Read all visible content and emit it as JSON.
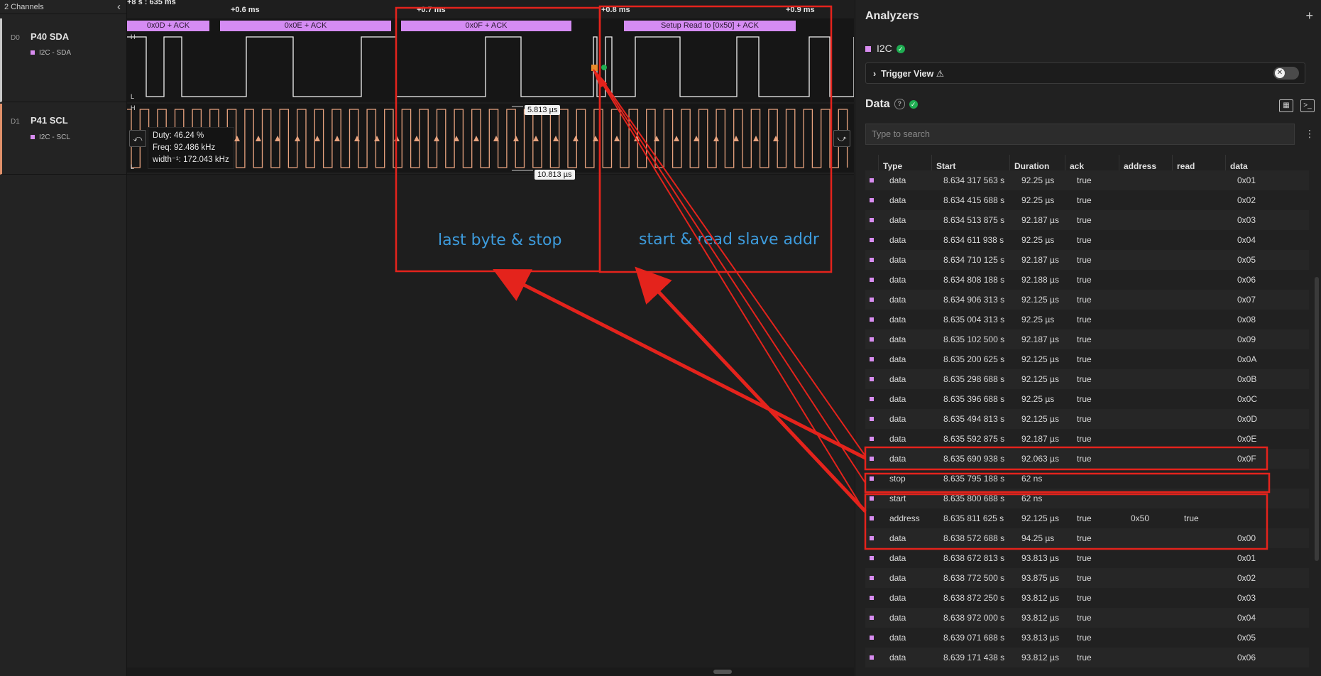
{
  "left_panel": {
    "header": "2 Channels",
    "channels": [
      {
        "index": "D0",
        "name": "P40 SDA",
        "analyzer": "I2C - SDA"
      },
      {
        "index": "D1",
        "name": "P41 SCL",
        "analyzer": "I2C - SCL"
      }
    ]
  },
  "timeline": {
    "ticks": [
      "+8 s : 635 ms",
      "+0.6 ms",
      "+0.7 ms",
      "+0.8 ms",
      "+0.9 ms"
    ],
    "frames": [
      "0x0D + ACK",
      "0x0E + ACK",
      "0x0F + ACK",
      "Setup Read to [0x50] + ACK"
    ],
    "measurements": [
      "5.813 µs",
      "10.813 µs"
    ],
    "tooltip": {
      "duty": "Duty: 46.24 %",
      "freq": "Freq: 92.486 kHz",
      "width": "width⁻¹: 172.043 kHz"
    },
    "level_labels": {
      "high": "H",
      "low": "L"
    }
  },
  "annotations": {
    "box1_label": "last byte & stop",
    "box2_label": "start & read slave addr",
    "color": "#e4231c"
  },
  "analyzers": {
    "title": "Analyzers",
    "add": "+",
    "analyzer_name": "I2C",
    "trigger_label": "Trigger View ⚠",
    "data_title": "Data",
    "search_placeholder": "Type to search",
    "columns": [
      "Type",
      "Start",
      "Duration",
      "ack",
      "address",
      "read",
      "data"
    ],
    "rows": [
      [
        "data",
        "8.634 317 563 s",
        "92.25 µs",
        "true",
        "",
        "",
        "0x01"
      ],
      [
        "data",
        "8.634 415 688 s",
        "92.25 µs",
        "true",
        "",
        "",
        "0x02"
      ],
      [
        "data",
        "8.634 513 875 s",
        "92.187 µs",
        "true",
        "",
        "",
        "0x03"
      ],
      [
        "data",
        "8.634 611 938 s",
        "92.25 µs",
        "true",
        "",
        "",
        "0x04"
      ],
      [
        "data",
        "8.634 710 125 s",
        "92.187 µs",
        "true",
        "",
        "",
        "0x05"
      ],
      [
        "data",
        "8.634 808 188 s",
        "92.188 µs",
        "true",
        "",
        "",
        "0x06"
      ],
      [
        "data",
        "8.634 906 313 s",
        "92.125 µs",
        "true",
        "",
        "",
        "0x07"
      ],
      [
        "data",
        "8.635 004 313 s",
        "92.25 µs",
        "true",
        "",
        "",
        "0x08"
      ],
      [
        "data",
        "8.635 102 500 s",
        "92.187 µs",
        "true",
        "",
        "",
        "0x09"
      ],
      [
        "data",
        "8.635 200 625 s",
        "92.125 µs",
        "true",
        "",
        "",
        "0x0A"
      ],
      [
        "data",
        "8.635 298 688 s",
        "92.125 µs",
        "true",
        "",
        "",
        "0x0B"
      ],
      [
        "data",
        "8.635 396 688 s",
        "92.25 µs",
        "true",
        "",
        "",
        "0x0C"
      ],
      [
        "data",
        "8.635 494 813 s",
        "92.125 µs",
        "true",
        "",
        "",
        "0x0D"
      ],
      [
        "data",
        "8.635 592 875 s",
        "92.187 µs",
        "true",
        "",
        "",
        "0x0E"
      ],
      [
        "data",
        "8.635 690 938 s",
        "92.063 µs",
        "true",
        "",
        "",
        "0x0F"
      ],
      [
        "stop",
        "8.635 795 188 s",
        "62 ns",
        "",
        "",
        "",
        ""
      ],
      [
        "start",
        "8.635 800 688 s",
        "62 ns",
        "",
        "",
        "",
        ""
      ],
      [
        "address",
        "8.635 811 625 s",
        "92.125 µs",
        "true",
        "0x50",
        "true",
        ""
      ],
      [
        "data",
        "8.638 572 688 s",
        "94.25 µs",
        "true",
        "",
        "",
        "0x00"
      ],
      [
        "data",
        "8.638 672 813 s",
        "93.813 µs",
        "true",
        "",
        "",
        "0x01"
      ],
      [
        "data",
        "8.638 772 500 s",
        "93.875 µs",
        "true",
        "",
        "",
        "0x02"
      ],
      [
        "data",
        "8.638 872 250 s",
        "93.812 µs",
        "true",
        "",
        "",
        "0x03"
      ],
      [
        "data",
        "8.638 972 000 s",
        "93.812 µs",
        "true",
        "",
        "",
        "0x04"
      ],
      [
        "data",
        "8.639 071 688 s",
        "93.813 µs",
        "true",
        "",
        "",
        "0x05"
      ],
      [
        "data",
        "8.639 171 438 s",
        "93.812 µs",
        "true",
        "",
        "",
        "0x06"
      ]
    ]
  }
}
